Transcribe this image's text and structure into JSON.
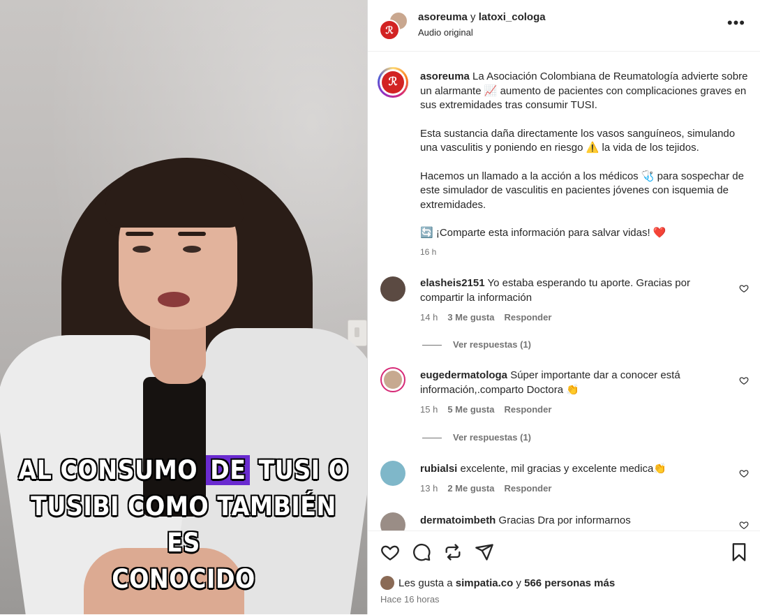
{
  "video": {
    "caption_lines": [
      {
        "before": "AL CONSUMO ",
        "highlight": "DE",
        "after": " TUSI O"
      },
      {
        "before": "TUSIBI COMO TAMBIÉN ES",
        "highlight": "",
        "after": ""
      },
      {
        "before": "CONOCIDO",
        "highlight": "",
        "after": ""
      }
    ]
  },
  "header": {
    "user1": "asoreuma",
    "joiner": " y ",
    "user2": "latoxi_cologa",
    "subtitle": "Audio original",
    "more_label": "•••"
  },
  "caption": {
    "username": "asoreuma",
    "paragraphs": [
      "La Asociación Colombiana de Reumatología advierte sobre un alarmante 📈 aumento de pacientes con complicaciones graves en sus extremidades tras consumir TUSI.",
      "Esta sustancia daña directamente los vasos sanguíneos, simulando una vasculitis y poniendo en riesgo ⚠️ la vida de los tejidos.",
      "Hacemos un llamado a la acción a los médicos 🩺 para sospechar de este simulador de vasculitis en pacientes jóvenes con isquemia de extremidades.",
      "🔄 ¡Comparte esta información para salvar vidas! ❤️"
    ],
    "time": "16 h"
  },
  "comments": [
    {
      "username": "elasheis2151",
      "text": "Yo estaba esperando tu aporte. Gracias por compartir la información",
      "time": "14 h",
      "likes": "3 Me gusta",
      "reply": "Responder",
      "replies": "Ver respuestas (1)",
      "avatar_color": "#5b4a42"
    },
    {
      "username": "eugedermatologa",
      "text": "Súper importante dar a conocer está información,.comparto Doctora 👏",
      "time": "15 h",
      "likes": "5 Me gusta",
      "reply": "Responder",
      "replies": "Ver respuestas (1)",
      "avatar_color": "#c7a990"
    },
    {
      "username": "rubialsi",
      "text": "excelente, mil gracias y excelente medica👏",
      "time": "13 h",
      "likes": "2 Me gusta",
      "reply": "Responder",
      "replies": "",
      "avatar_color": "#7fb7c9"
    },
    {
      "username": "dermatoimbeth",
      "text": "Gracias Dra por informarnos",
      "time": "",
      "likes": "",
      "reply": "",
      "replies": "",
      "avatar_color": "#9a8d86"
    }
  ],
  "footer": {
    "likes_prefix": "Les gusta a ",
    "liker": "simpatia.co",
    "likes_mid": " y ",
    "others": "566 personas más",
    "ago": "Hace 16 horas"
  }
}
